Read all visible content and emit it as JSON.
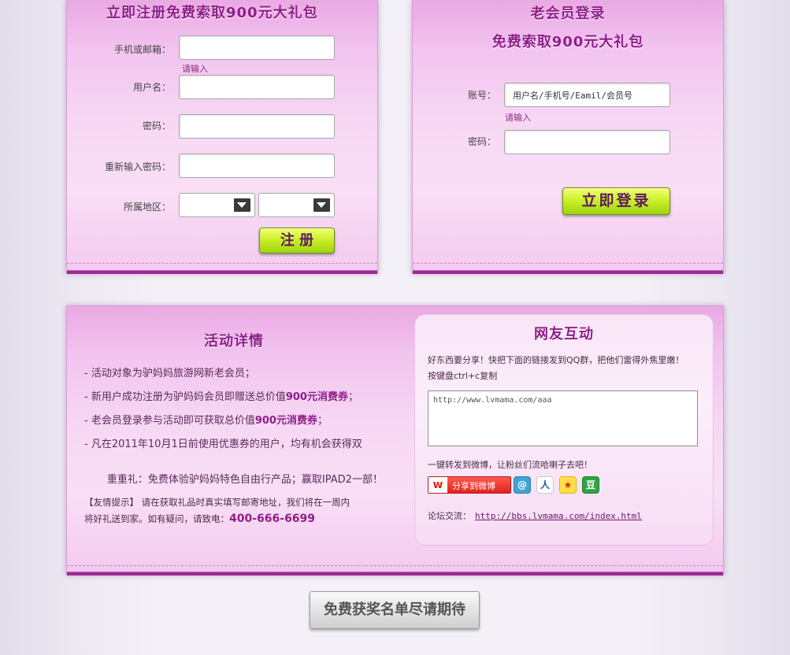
{
  "register": {
    "title": "立即注册免费索取900元大礼包",
    "phone_label": "手机或邮箱：",
    "phone_hint": "请输入",
    "username_label": "用户名：",
    "password_label": "密码：",
    "repassword_label": "重新输入密码：",
    "region_label": "所属地区：",
    "submit_label": "注 册"
  },
  "login": {
    "title_line1": "老会员登录",
    "title_line2": "免费索取900元大礼包",
    "account_label": "账号：",
    "account_value": "用户名/手机号/Eamil/会员号",
    "account_hint": "请输入",
    "password_label": "密码：",
    "submit_label": "立即登录"
  },
  "details": {
    "title": "活动详情",
    "items": [
      {
        "prefix": "-  活动对象为驴妈妈旅游网新老会员；",
        "bold": ""
      },
      {
        "prefix": "-  新用户成功注册为驴妈妈会员即赠送总价值",
        "bold": "900元消费券",
        "suffix": "；"
      },
      {
        "prefix": "-  老会员登录参与活动即可获取总价值",
        "bold": "900元消费券",
        "suffix": "；"
      },
      {
        "prefix": "-  凡在2011年10月1日前使用优惠券的用户，均有机会获得双",
        "bold": ""
      },
      {
        "prefix": "   重重礼：免费体验驴妈妈特色自由行产品；赢取IPAD2一部！",
        "bold": ""
      }
    ],
    "tip_line1": "【友情提示】 请在获取礼品时真实填写邮寄地址，我们将在一周内",
    "tip_line2": "将好礼送到家。如有疑问，请致电：",
    "phone": "400-666-6699"
  },
  "interact": {
    "title": "网友互动",
    "desc_line1": "好东西要分享！快把下面的链接发到QQ群，把他们雷得外焦里嫩！",
    "desc_line2": "按键盘ctrl+c复制",
    "share_url": "http://www.lvmama.com/aaa",
    "forward_text": "一键转发到微博，让粉丝们流哈喇子去吧！",
    "weibo_label": "分享到微博",
    "forum_label": "论坛交流：",
    "forum_url": "http://bbs.lvmama.com/index.html"
  },
  "footer": {
    "winners_label": "免费获奖名单尽请期待"
  },
  "colors": {
    "accent": "#8e1f8a",
    "button_green": "#c8ee27",
    "bottom_bar": "#9b2b92"
  }
}
